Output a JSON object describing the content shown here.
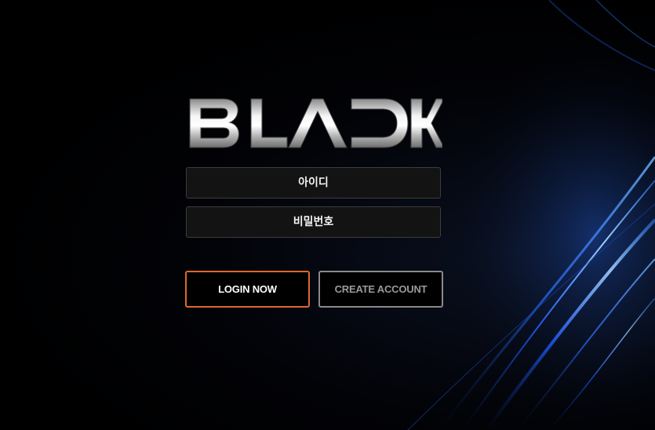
{
  "brand": {
    "logo_text": "BLACK"
  },
  "form": {
    "id_placeholder": "아이디",
    "password_placeholder": "비밀번호"
  },
  "buttons": {
    "login_label": "LOGIN NOW",
    "create_label": "CREATE ACCOUNT"
  },
  "colors": {
    "login_border": "#e0672a",
    "create_border": "#8a8a8a",
    "field_bg": "#131313",
    "light_streak": "#2f7dff"
  }
}
